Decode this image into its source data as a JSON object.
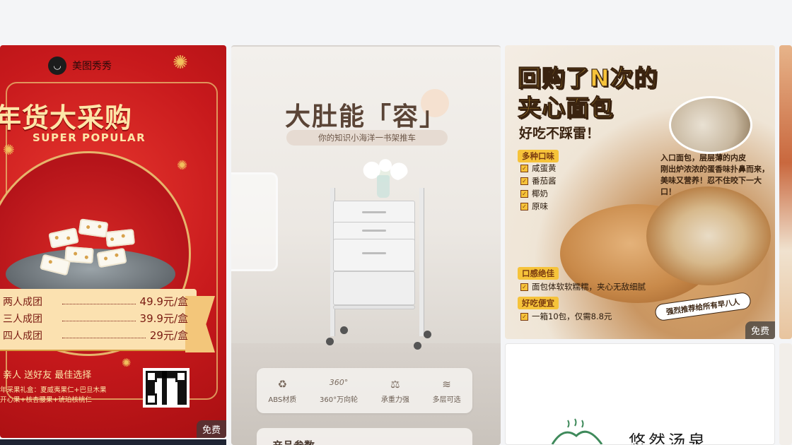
{
  "cards": [
    {
      "brand": "美图秀秀",
      "title": "年货大采购",
      "subtitle": "SUPER POPULAR",
      "price_rows": [
        {
          "label": "两人成团",
          "price": "49.9元/盒"
        },
        {
          "label": "三人成团",
          "price": "39.9元/盒"
        },
        {
          "label": "四人成团",
          "price": "29元/盒"
        }
      ],
      "tagline": "亲人 送好友 最佳选择",
      "fineprint": [
        "年采果礼盒：夏威夷果仁+巴旦木果",
        "开心果+核杏腰果+琥珀核桃仁"
      ],
      "badge": "免费"
    },
    {
      "title": "大肚能「容」",
      "subtitle": "你的知识小海洋一书架推车",
      "features": [
        {
          "icon": "recycle-icon",
          "glyph": "♻",
          "label": "ABS材质"
        },
        {
          "icon": "rotate-360-icon",
          "glyph": "360°",
          "label": "360°万向轮"
        },
        {
          "icon": "weight-icon",
          "glyph": "⚖",
          "label": "承重力强"
        },
        {
          "icon": "layers-icon",
          "glyph": "≋",
          "label": "多层可选"
        }
      ],
      "params_label": "产品参数"
    },
    {
      "headline_1": "回购了N次的",
      "headline_2": "夹心面包",
      "tagline": "好吃不踩雷！",
      "note_1": "入口面包，层层薄的内皮",
      "note_2": "刚出炉浓浓的蛋香味扑鼻而来，",
      "note_3": "美味又营养！忍不住咬下一大口！",
      "section_flavors": "多种口味",
      "flavors": [
        "咸蛋黄",
        "番茄酱",
        "椰奶",
        "原味"
      ],
      "section_taste": "口感绝佳",
      "taste_text": "面包体软软糯糯，夹心无敌细腻",
      "section_price": "好吃便宜",
      "price_text": "一箱10包，仅需8.8元",
      "reco": "强烈推荐给所有早八人",
      "badge": "免费"
    },
    {
      "logo_text": "悠然汤泉"
    }
  ],
  "colors": {
    "newyear_red": "#c7191c",
    "gold": "#fde6a8",
    "bread_yellow": "#f6c33a",
    "trolley_brown": "#5a4436",
    "badge_bg": "#3c3c3c"
  }
}
